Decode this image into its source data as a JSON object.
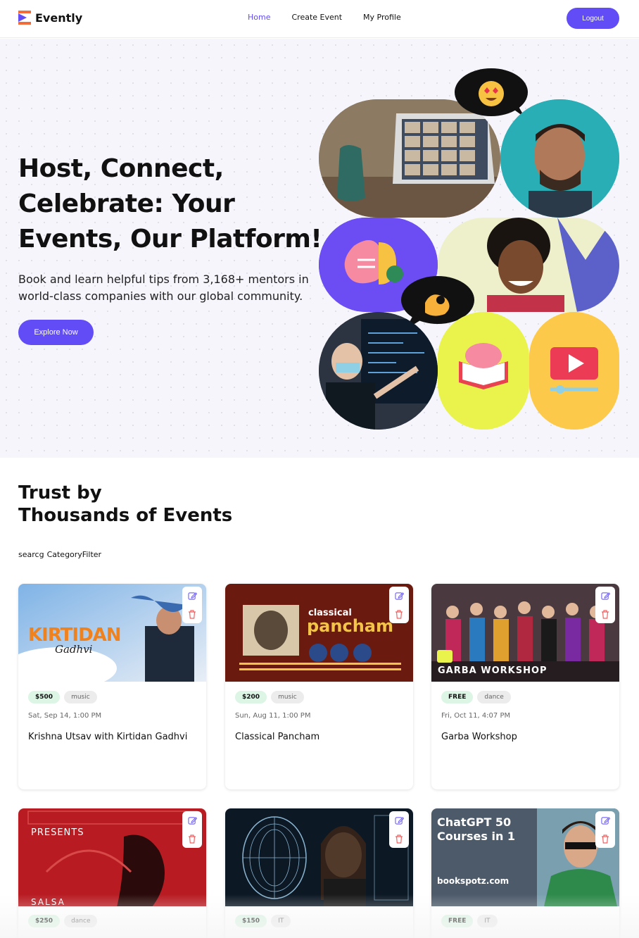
{
  "brand": {
    "name": "Evently",
    "accent": "#624cf5"
  },
  "nav": {
    "home": "Home",
    "create_event": "Create Event",
    "my_profile": "My Profile",
    "logout": "Logout"
  },
  "hero": {
    "title": "Host, Connect, Celebrate: Your Events, Our Platform!",
    "subtitle": "Book and learn helpful tips from 3,168+ mentors in world-class companies with our global community.",
    "cta": "Explore Now"
  },
  "section": {
    "title_line1": "Trust by",
    "title_line2": "Thousands of Events"
  },
  "filters": {
    "search_label": "searcg",
    "category_label": "CategoryFilter"
  },
  "events": [
    {
      "price": "$500",
      "category": "music",
      "date": "Sat, Sep 14, 1:00 PM",
      "title": "Krishna Utsav with Kirtidan Gadhvi",
      "banner_text": "KIRTIDAN",
      "banner_sub": "Gadhvi"
    },
    {
      "price": "$200",
      "category": "music",
      "date": "Sun, Aug 11, 1:00 PM",
      "title": "Classical Pancham",
      "banner_text": "pancham",
      "banner_sub": "classical"
    },
    {
      "price": "FREE",
      "category": "dance",
      "date": "Fri, Oct 11, 4:07 PM",
      "title": "Garba Workshop",
      "banner_text": "GARBA WORKSHOP",
      "banner_sub": ""
    },
    {
      "price": "$250",
      "category": "dance",
      "date": "",
      "title": "",
      "banner_text": "PRESENTS",
      "banner_sub": "SALSA"
    },
    {
      "price": "$150",
      "category": "IT",
      "date": "",
      "title": "",
      "banner_text": "",
      "banner_sub": ""
    },
    {
      "price": "FREE",
      "category": "IT",
      "date": "",
      "title": "",
      "banner_text": "ChatGPT 50 Courses in 1",
      "banner_sub": "bookspotz.com"
    }
  ]
}
